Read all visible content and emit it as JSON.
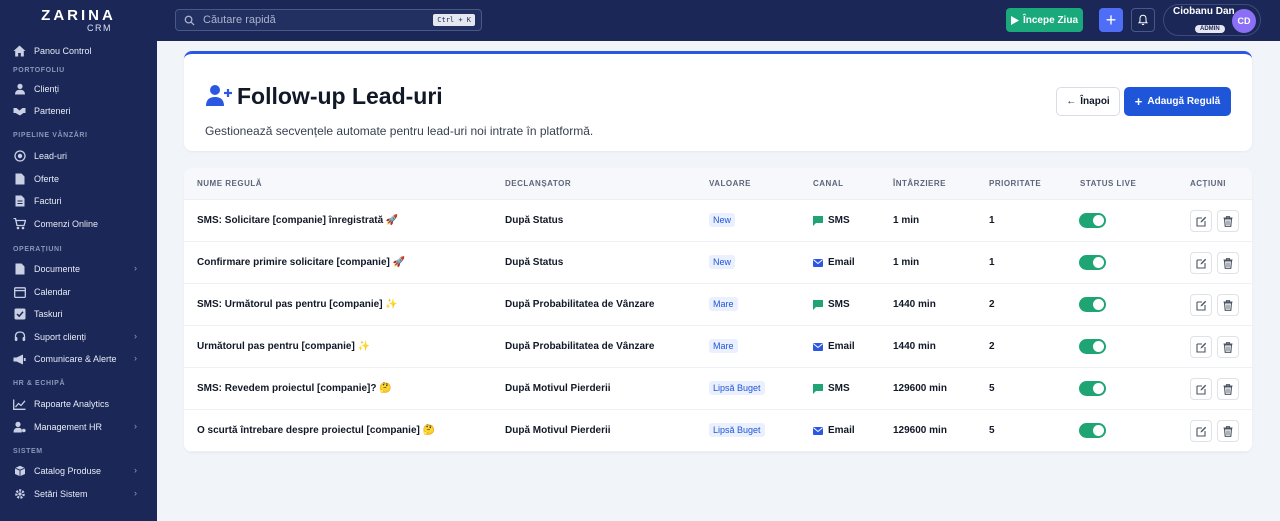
{
  "app": {
    "logo_top": "ZARINA",
    "logo_bottom": "CRM"
  },
  "topbar": {
    "search_placeholder": "Căutare rapidă",
    "search_shortcut": "Ctrl + K",
    "start_label": "Începe Ziua",
    "user_name": "Ciobanu Dan",
    "user_role": "ADMIN",
    "user_initials": "CD"
  },
  "sidebar": {
    "dashboard": "Panou Control",
    "sec_portfolio": "PORTOFOLIU",
    "clients": "Clienți",
    "partners": "Parteneri",
    "sec_pipeline": "PIPELINE VÂNZĂRI",
    "leads": "Lead-uri",
    "offers": "Oferte",
    "invoices": "Facturi",
    "online_orders": "Comenzi Online",
    "sec_operations": "OPERAȚIUNI",
    "documents": "Documente",
    "calendar": "Calendar",
    "tasks": "Taskuri",
    "client_support": "Suport clienți",
    "communication": "Comunicare & Alerte",
    "sec_hr": "HR & ECHIPĂ",
    "analytics": "Rapoarte Analytics",
    "hr_management": "Management HR",
    "sec_system": "SISTEM",
    "product_catalog": "Catalog Produse",
    "system_settings": "Setări Sistem"
  },
  "header": {
    "title": "Follow-up Lead-uri",
    "subtitle": "Gestionează secvențele automate pentru lead-uri noi intrate în platformă.",
    "back_label": "Înapoi",
    "add_label": "Adaugă Regulă"
  },
  "table": {
    "columns": {
      "name": "NUME REGULĂ",
      "trigger": "DECLANȘATOR",
      "value": "VALOARE",
      "channel": "CANAL",
      "delay": "ÎNTÂRZIERE",
      "priority": "PRIORITATE",
      "status": "STATUS LIVE",
      "actions": "ACȚIUNI"
    },
    "rows": [
      {
        "name": "SMS: Solicitare [companie] înregistrată 🚀",
        "trigger": "După Status",
        "value": "New",
        "channel": "SMS",
        "channel_icon": "chat-icon",
        "delay": "1 min",
        "priority": "1",
        "live": true
      },
      {
        "name": "Confirmare primire solicitare [companie] 🚀",
        "trigger": "După Status",
        "value": "New",
        "channel": "Email",
        "channel_icon": "mail-icon",
        "delay": "1 min",
        "priority": "1",
        "live": true
      },
      {
        "name": "SMS: Următorul pas pentru [companie] ✨",
        "trigger": "După Probabilitatea de Vânzare",
        "value": "Mare",
        "channel": "SMS",
        "channel_icon": "chat-icon",
        "delay": "1440 min",
        "priority": "2",
        "live": true
      },
      {
        "name": "Următorul pas pentru [companie] ✨",
        "trigger": "După Probabilitatea de Vânzare",
        "value": "Mare",
        "channel": "Email",
        "channel_icon": "mail-icon",
        "delay": "1440 min",
        "priority": "2",
        "live": true
      },
      {
        "name": "SMS: Revedem proiectul [companie]? 🤔",
        "trigger": "După Motivul Pierderii",
        "value": "Lipsă Buget",
        "channel": "SMS",
        "channel_icon": "chat-icon",
        "delay": "129600 min",
        "priority": "5",
        "live": true
      },
      {
        "name": "O scurtă întrebare despre proiectul [companie] 🤔",
        "trigger": "După Motivul Pierderii",
        "value": "Lipsă Buget",
        "channel": "Email",
        "channel_icon": "mail-icon",
        "delay": "129600 min",
        "priority": "5",
        "live": true
      }
    ]
  },
  "colors": {
    "navy": "#1a2757",
    "accent_blue": "#1f56d9",
    "green": "#1fa574",
    "start_green": "#19a97a",
    "avatar_purple": "#8b6ff5"
  }
}
